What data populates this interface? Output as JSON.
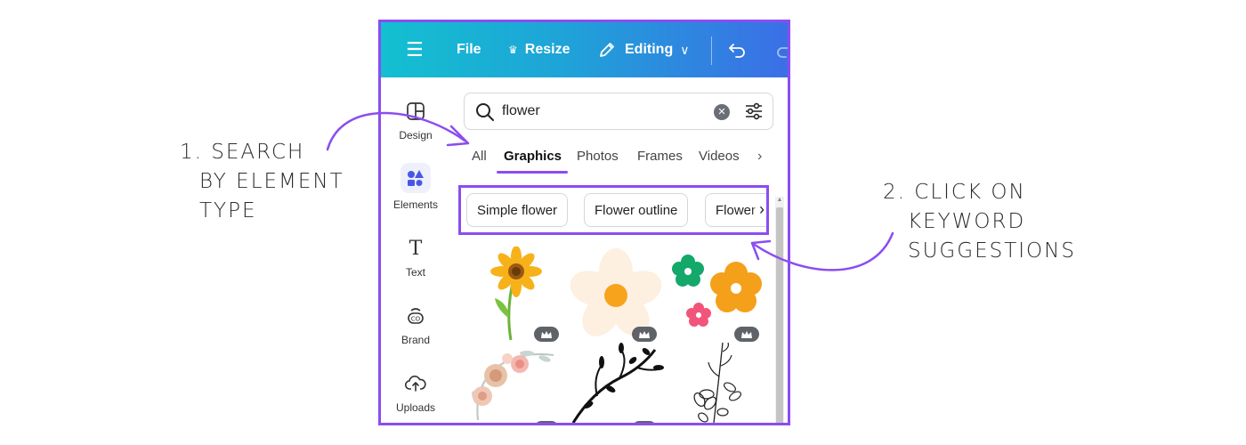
{
  "annotations": {
    "left": {
      "line1": "1. SEARCH",
      "line2": "BY ELEMENT",
      "line3": "TYPE"
    },
    "right": {
      "line1": "2. CLICK ON",
      "line2": "KEYWORD",
      "line3": "SUGGESTIONS"
    },
    "accent_color": "#8b4df0"
  },
  "topbar": {
    "menu_icon": "☰",
    "file_label": "File",
    "resize_label": "Resize",
    "editing_label": "Editing"
  },
  "sidebar": {
    "items": [
      {
        "label": "Design",
        "icon": "design-icon"
      },
      {
        "label": "Elements",
        "icon": "elements-icon"
      },
      {
        "label": "Text",
        "icon": "text-icon"
      },
      {
        "label": "Brand",
        "icon": "brand-icon"
      },
      {
        "label": "Uploads",
        "icon": "uploads-icon"
      }
    ]
  },
  "search": {
    "value": "flower"
  },
  "tabs": [
    "All",
    "Graphics",
    "Photos",
    "Frames",
    "Videos"
  ],
  "active_tab": "Graphics",
  "suggestions": [
    "Simple flower",
    "Flower outline",
    "Flower"
  ],
  "results": [
    {
      "name": "yellow-flower-graphic",
      "premium": true
    },
    {
      "name": "cream-daisy-graphic",
      "premium": true
    },
    {
      "name": "colorful-flowers-graphic",
      "premium": true
    },
    {
      "name": "watercolor-floral-wreath-graphic",
      "premium": true
    },
    {
      "name": "black-branch-silhouette-graphic",
      "premium": true
    },
    {
      "name": "floral-line-art-graphic",
      "premium": false
    }
  ]
}
